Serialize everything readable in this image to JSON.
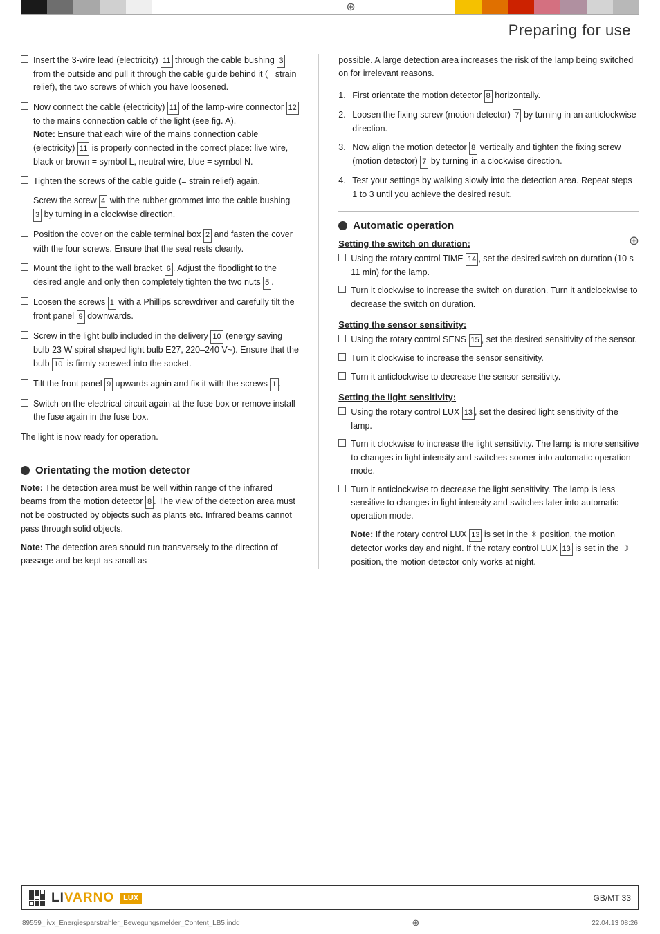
{
  "header": {
    "section_title": "Preparing for use",
    "compass_symbol": "⊕"
  },
  "top_bar": {
    "left_segments": [
      "black",
      "gray1",
      "gray2",
      "gray3",
      "white"
    ],
    "right_segments": [
      "yellow",
      "orange",
      "red",
      "pink",
      "mauve",
      "ltgray",
      "midgray"
    ]
  },
  "left_column": {
    "bullet_items": [
      {
        "id": "b1",
        "text_parts": [
          {
            "type": "text",
            "value": "Insert the 3-wire lead (electricity) "
          },
          {
            "type": "box",
            "value": "11"
          },
          {
            "type": "text",
            "value": " through the cable bushing "
          },
          {
            "type": "box",
            "value": "3"
          },
          {
            "type": "text",
            "value": " from the outside and pull it through the cable guide behind it (= strain relief), the two screws of which you have loosened."
          }
        ]
      },
      {
        "id": "b2",
        "text_parts": [
          {
            "type": "text",
            "value": "Now connect the cable (electricity) "
          },
          {
            "type": "box",
            "value": "11"
          },
          {
            "type": "text",
            "value": " of the lamp-wire connector "
          },
          {
            "type": "box",
            "value": "12"
          },
          {
            "type": "text",
            "value": " to the mains connection cable of the light (see fig. A)."
          },
          {
            "type": "note",
            "value": "Note:"
          },
          {
            "type": "text",
            "value": " Ensure that each wire of the mains connection cable (electricity) "
          },
          {
            "type": "box",
            "value": "11"
          },
          {
            "type": "text",
            "value": " is properly connected in the correct place: live wire, black or brown = symbol L, neutral wire, blue = symbol N."
          }
        ]
      },
      {
        "id": "b3",
        "text_parts": [
          {
            "type": "text",
            "value": "Tighten the screws of the cable guide (= strain relief) again."
          }
        ]
      },
      {
        "id": "b4",
        "text_parts": [
          {
            "type": "text",
            "value": "Screw the screw "
          },
          {
            "type": "box",
            "value": "4"
          },
          {
            "type": "text",
            "value": " with the rubber grommet into the cable bushing "
          },
          {
            "type": "box",
            "value": "3"
          },
          {
            "type": "text",
            "value": " by turning in a clockwise direction."
          }
        ]
      },
      {
        "id": "b5",
        "text_parts": [
          {
            "type": "text",
            "value": "Position the cover on the cable terminal box "
          },
          {
            "type": "box",
            "value": "2"
          },
          {
            "type": "text",
            "value": " and fasten the cover with the four screws. Ensure that the seal rests cleanly."
          }
        ]
      },
      {
        "id": "b6",
        "text_parts": [
          {
            "type": "text",
            "value": "Mount the light to the wall bracket "
          },
          {
            "type": "box",
            "value": "6"
          },
          {
            "type": "text",
            "value": ". Adjust the floodlight to the desired angle and only then completely tighten the two nuts "
          },
          {
            "type": "box",
            "value": "5"
          },
          {
            "type": "text",
            "value": "."
          }
        ]
      },
      {
        "id": "b7",
        "text_parts": [
          {
            "type": "text",
            "value": "Loosen the screws "
          },
          {
            "type": "box",
            "value": "1"
          },
          {
            "type": "text",
            "value": " with a Phillips screwdriver and carefully tilt the front panel "
          },
          {
            "type": "box",
            "value": "9"
          },
          {
            "type": "text",
            "value": " downwards."
          }
        ]
      },
      {
        "id": "b8",
        "text_parts": [
          {
            "type": "text",
            "value": "Screw in the light bulb included in the delivery "
          },
          {
            "type": "box",
            "value": "10"
          },
          {
            "type": "text",
            "value": " (energy saving bulb 23 W spiral shaped light bulb E27, 220–240 V~). Ensure that the bulb "
          },
          {
            "type": "box",
            "value": "10"
          },
          {
            "type": "text",
            "value": " is firmly screwed into the socket."
          }
        ]
      },
      {
        "id": "b9",
        "text_parts": [
          {
            "type": "text",
            "value": "Tilt the front panel "
          },
          {
            "type": "box",
            "value": "9"
          },
          {
            "type": "text",
            "value": " upwards again and fix it with the screws "
          },
          {
            "type": "box",
            "value": "1"
          },
          {
            "type": "text",
            "value": "."
          }
        ]
      },
      {
        "id": "b10",
        "text_parts": [
          {
            "type": "text",
            "value": "Switch on the electrical circuit again at the fuse box or remove install the fuse again in the fuse box."
          }
        ]
      }
    ],
    "light_ready": "The light is now ready for operation.",
    "orientating_section": {
      "heading": "Orientating the motion detector",
      "note1_bold": "Note:",
      "note1_text": " The detection area must be well within range of the infrared beams from the motion detector ",
      "note1_box": "8",
      "note1_cont": ". The view of the detection area must not be obstructed by objects such as plants etc. Infrared beams cannot pass through solid objects.",
      "note2_bold": "Note:",
      "note2_text": " The detection area should run transversely to the direction of passage and be kept as small as"
    }
  },
  "right_column": {
    "continued_text": "possible. A large detection area increases the risk of the lamp being switched on for irrelevant reasons.",
    "numbered_items": [
      {
        "num": "1.",
        "text_parts": [
          {
            "type": "text",
            "value": "First orientate the motion detector "
          },
          {
            "type": "box",
            "value": "8"
          },
          {
            "type": "text",
            "value": " horizontally."
          }
        ]
      },
      {
        "num": "2.",
        "text_parts": [
          {
            "type": "text",
            "value": "Loosen the fixing screw (motion detector) "
          },
          {
            "type": "box",
            "value": "7"
          },
          {
            "type": "text",
            "value": " by turning in an anticlockwise direction."
          }
        ]
      },
      {
        "num": "3.",
        "text_parts": [
          {
            "type": "text",
            "value": "Now align the motion detector "
          },
          {
            "type": "box",
            "value": "8"
          },
          {
            "type": "text",
            "value": " vertically and tighten the fixing screw (motion detector) "
          },
          {
            "type": "box",
            "value": "7"
          },
          {
            "type": "text",
            "value": " by turning in a clockwise direction."
          }
        ]
      },
      {
        "num": "4.",
        "text_parts": [
          {
            "type": "text",
            "value": "Test your settings by walking slowly into the detection area. Repeat steps 1 to 3 until you achieve the desired result."
          }
        ]
      }
    ],
    "automatic_section": {
      "heading": "Automatic operation",
      "switch_on_heading": "Setting the switch on duration:",
      "switch_on_items": [
        {
          "text_parts": [
            {
              "type": "text",
              "value": "Using the rotary control TIME "
            },
            {
              "type": "box",
              "value": "14"
            },
            {
              "type": "text",
              "value": ", set the desired switch on duration (10 s– 11 min) for the lamp."
            }
          ]
        },
        {
          "text_parts": [
            {
              "type": "text",
              "value": "Turn it clockwise to increase the switch on duration. Turn it anticlockwise to decrease the switch on duration."
            }
          ]
        }
      ],
      "sensor_heading": "Setting the sensor sensitivity:",
      "sensor_items": [
        {
          "text_parts": [
            {
              "type": "text",
              "value": "Using the rotary control SENS "
            },
            {
              "type": "box",
              "value": "15"
            },
            {
              "type": "text",
              "value": ", set the desired sensitivity of the sensor."
            }
          ]
        },
        {
          "text_parts": [
            {
              "type": "text",
              "value": "Turn it clockwise to increase the sensor sensitivity."
            }
          ]
        },
        {
          "text_parts": [
            {
              "type": "text",
              "value": "Turn it anticlockwise to decrease the sensor sensitivity."
            }
          ]
        }
      ],
      "light_heading": "Setting the light sensitivity:",
      "light_items": [
        {
          "text_parts": [
            {
              "type": "text",
              "value": "Using the rotary control LUX "
            },
            {
              "type": "box",
              "value": "13"
            },
            {
              "type": "text",
              "value": ", set the desired light sensitivity of the lamp."
            }
          ]
        },
        {
          "text_parts": [
            {
              "type": "text",
              "value": "Turn it clockwise to increase the light sensitivity. The lamp is more sensitive to changes in light intensity and switches sooner into automatic operation mode."
            }
          ]
        },
        {
          "text_parts": [
            {
              "type": "text",
              "value": "Turn it anticlockwise to decrease the light sensitivity. The lamp is less sensitive to changes in light intensity and switches later into automatic operation mode."
            }
          ]
        }
      ],
      "light_note_bold": "Note:",
      "light_note_text": " If the rotary control LUX ",
      "light_note_box1": "13",
      "light_note_mid": " is set in the ✳ position, the motion detector works day and night. If the rotary control LUX ",
      "light_note_box2": "13",
      "light_note_end": " is set in the ☽ position, the motion detector only works at night."
    }
  },
  "footer": {
    "logo_text_li": "LI",
    "logo_text_varno": "VARNO",
    "logo_lux": "LUX",
    "file_info": "89559_livx_Energiesparstrahler_Bewegungsmelder_Content_LB5.indd",
    "compass": "⊕",
    "date_info": "22.04.13  08:26",
    "page_info": "GB/MT   33"
  }
}
